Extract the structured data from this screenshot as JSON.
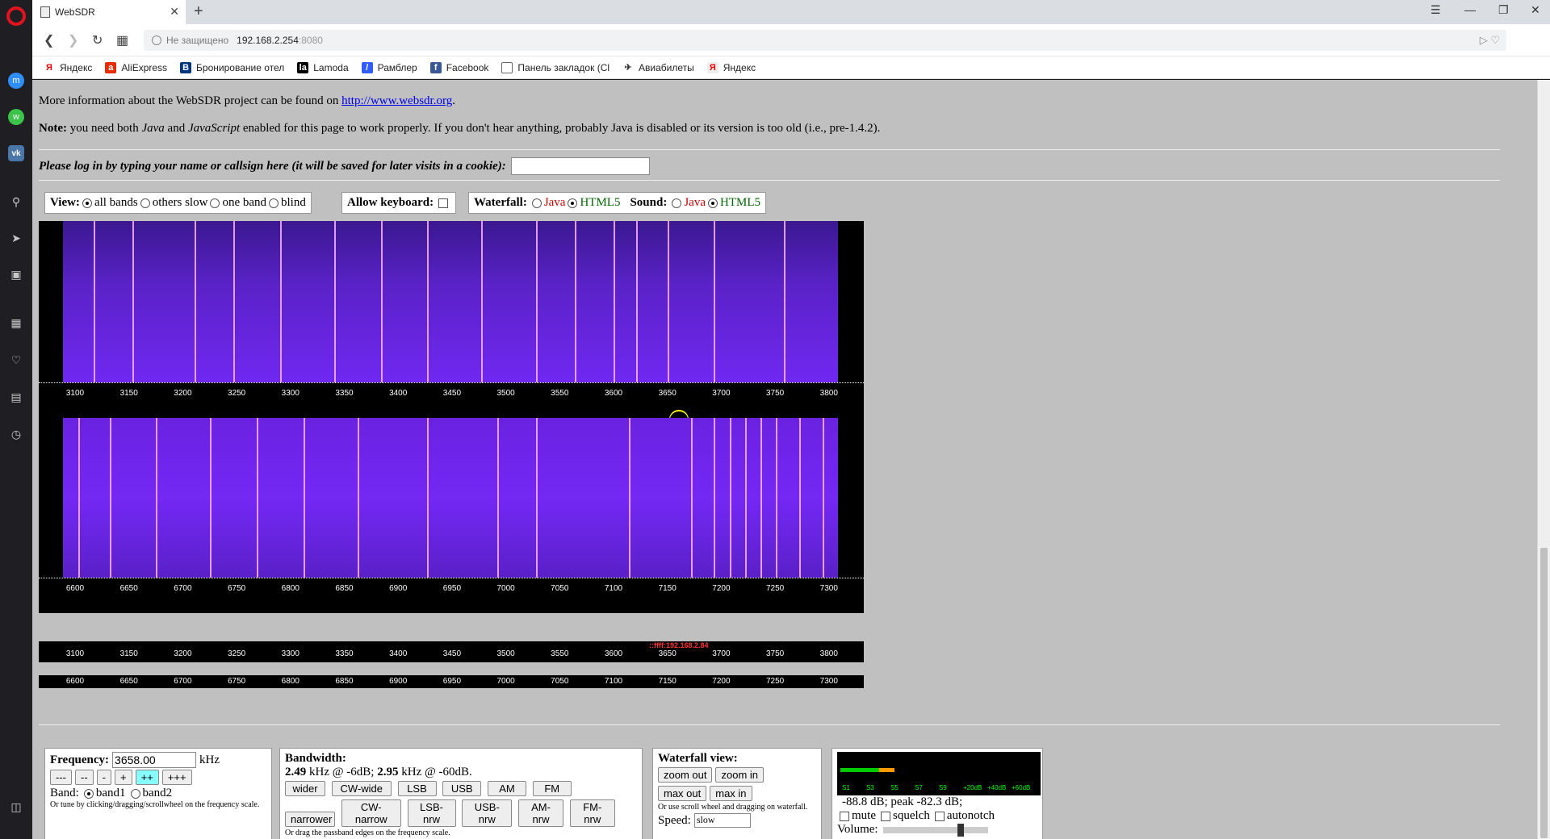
{
  "browser": {
    "tab_title": "WebSDR",
    "address_not_secure": "Не защищено",
    "address_host": "192.168.2.254",
    "address_port": ":8080",
    "bookmarks": [
      "Яндекс",
      "AliExpress",
      "Бронирование отел",
      "Lamoda",
      "Рамблер",
      "Facebook",
      "Панель закладок (Cl",
      "Авиабилеты",
      "Яндекс"
    ]
  },
  "page": {
    "info_text": "More information about the WebSDR project can be found on",
    "info_link": "http://www.websdr.org",
    "note_label": "Note:",
    "note_text_1": " you need both ",
    "note_java": "Java",
    "note_text_2": " and ",
    "note_js": "JavaScript",
    "note_text_3": " enabled for this page to work properly. If you don't hear anything, probably Java is disabled or its version is too old (i.e., pre-1.4.2).",
    "login_prompt": "Please log in by typing your name or callsign here (it will be saved for later visits in a cookie):",
    "view_label": "View:",
    "view_options": [
      "all bands",
      "others slow",
      "one band",
      "blind"
    ],
    "allow_keyboard": "Allow keyboard:",
    "waterfall_label": "Waterfall:",
    "sound_label": "Sound:",
    "java": "Java",
    "html5": "HTML5"
  },
  "band1_ticks": [
    "3100",
    "3150",
    "3200",
    "3250",
    "3300",
    "3350",
    "3400",
    "3450",
    "3500",
    "3550",
    "3600",
    "3650",
    "3700",
    "3750",
    "3800"
  ],
  "band2_ticks": [
    "6600",
    "6650",
    "6700",
    "6750",
    "6800",
    "6850",
    "6900",
    "6950",
    "7000",
    "7050",
    "7100",
    "7150",
    "7200",
    "7250",
    "7300"
  ],
  "user_marker": "::ffff:192.168.2.84",
  "frequency": {
    "label": "Frequency:",
    "value": "3658.00",
    "unit": "kHz",
    "steps": [
      "---",
      "--",
      "-",
      "+",
      "++",
      "+++"
    ],
    "band_label": "Band:",
    "bands": [
      "band1",
      "band2"
    ],
    "hint": "Or tune by clicking/dragging/scrollwheel on the frequency scale."
  },
  "bandwidth": {
    "label": "Bandwidth:",
    "v6": "2.49",
    "t6": " kHz @ -6dB; ",
    "v60": "2.95",
    "t60": " kHz @ -60dB.",
    "row1": [
      "wider",
      "CW-wide",
      "LSB",
      "USB",
      "AM",
      "FM"
    ],
    "row2": [
      "narrower",
      "CW-narrow",
      "LSB-nrw",
      "USB-nrw",
      "AM-nrw",
      "FM-nrw"
    ],
    "hint": "Or drag the passband edges on the frequency scale."
  },
  "waterfall_view": {
    "label": "Waterfall view:",
    "buttons": [
      "zoom out",
      "zoom in",
      "max out",
      "max in"
    ],
    "hint": "Or use scroll wheel and dragging on waterfall.",
    "speed_label": "Speed:",
    "speed_value": "slow"
  },
  "signal": {
    "meter_labels": [
      "S1",
      "S3",
      "S5",
      "S7",
      "S9",
      "+20dB",
      "+40dB",
      "+60dB"
    ],
    "level_fraction": 0.28,
    "readout": "-88.8 dB; peak   -82.3 dB;",
    "mute": "mute",
    "squelch": "squelch",
    "autonotch": "autonotch",
    "volume": "Volume:"
  }
}
